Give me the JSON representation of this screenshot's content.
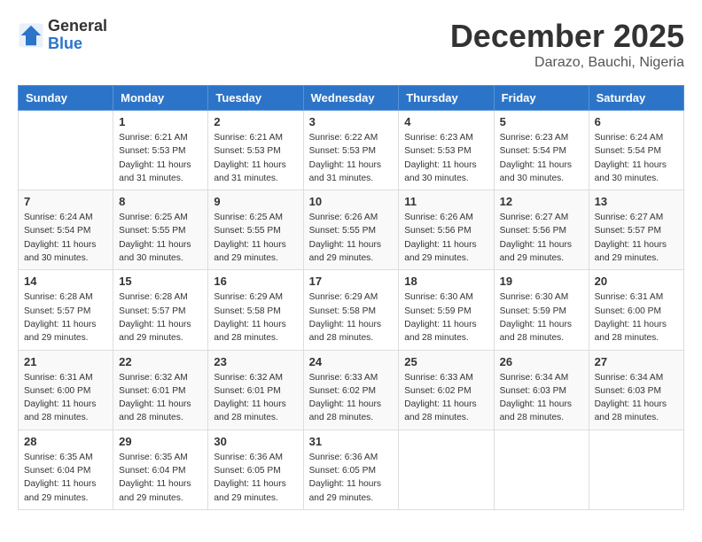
{
  "header": {
    "logo_line1": "General",
    "logo_line2": "Blue",
    "title": "December 2025",
    "subtitle": "Darazo, Bauchi, Nigeria"
  },
  "calendar": {
    "days_of_week": [
      "Sunday",
      "Monday",
      "Tuesday",
      "Wednesday",
      "Thursday",
      "Friday",
      "Saturday"
    ],
    "weeks": [
      [
        {
          "day": "",
          "sunrise": "",
          "sunset": "",
          "daylight": ""
        },
        {
          "day": "1",
          "sunrise": "Sunrise: 6:21 AM",
          "sunset": "Sunset: 5:53 PM",
          "daylight": "Daylight: 11 hours and 31 minutes."
        },
        {
          "day": "2",
          "sunrise": "Sunrise: 6:21 AM",
          "sunset": "Sunset: 5:53 PM",
          "daylight": "Daylight: 11 hours and 31 minutes."
        },
        {
          "day": "3",
          "sunrise": "Sunrise: 6:22 AM",
          "sunset": "Sunset: 5:53 PM",
          "daylight": "Daylight: 11 hours and 31 minutes."
        },
        {
          "day": "4",
          "sunrise": "Sunrise: 6:23 AM",
          "sunset": "Sunset: 5:53 PM",
          "daylight": "Daylight: 11 hours and 30 minutes."
        },
        {
          "day": "5",
          "sunrise": "Sunrise: 6:23 AM",
          "sunset": "Sunset: 5:54 PM",
          "daylight": "Daylight: 11 hours and 30 minutes."
        },
        {
          "day": "6",
          "sunrise": "Sunrise: 6:24 AM",
          "sunset": "Sunset: 5:54 PM",
          "daylight": "Daylight: 11 hours and 30 minutes."
        }
      ],
      [
        {
          "day": "7",
          "sunrise": "Sunrise: 6:24 AM",
          "sunset": "Sunset: 5:54 PM",
          "daylight": "Daylight: 11 hours and 30 minutes."
        },
        {
          "day": "8",
          "sunrise": "Sunrise: 6:25 AM",
          "sunset": "Sunset: 5:55 PM",
          "daylight": "Daylight: 11 hours and 30 minutes."
        },
        {
          "day": "9",
          "sunrise": "Sunrise: 6:25 AM",
          "sunset": "Sunset: 5:55 PM",
          "daylight": "Daylight: 11 hours and 29 minutes."
        },
        {
          "day": "10",
          "sunrise": "Sunrise: 6:26 AM",
          "sunset": "Sunset: 5:55 PM",
          "daylight": "Daylight: 11 hours and 29 minutes."
        },
        {
          "day": "11",
          "sunrise": "Sunrise: 6:26 AM",
          "sunset": "Sunset: 5:56 PM",
          "daylight": "Daylight: 11 hours and 29 minutes."
        },
        {
          "day": "12",
          "sunrise": "Sunrise: 6:27 AM",
          "sunset": "Sunset: 5:56 PM",
          "daylight": "Daylight: 11 hours and 29 minutes."
        },
        {
          "day": "13",
          "sunrise": "Sunrise: 6:27 AM",
          "sunset": "Sunset: 5:57 PM",
          "daylight": "Daylight: 11 hours and 29 minutes."
        }
      ],
      [
        {
          "day": "14",
          "sunrise": "Sunrise: 6:28 AM",
          "sunset": "Sunset: 5:57 PM",
          "daylight": "Daylight: 11 hours and 29 minutes."
        },
        {
          "day": "15",
          "sunrise": "Sunrise: 6:28 AM",
          "sunset": "Sunset: 5:57 PM",
          "daylight": "Daylight: 11 hours and 29 minutes."
        },
        {
          "day": "16",
          "sunrise": "Sunrise: 6:29 AM",
          "sunset": "Sunset: 5:58 PM",
          "daylight": "Daylight: 11 hours and 28 minutes."
        },
        {
          "day": "17",
          "sunrise": "Sunrise: 6:29 AM",
          "sunset": "Sunset: 5:58 PM",
          "daylight": "Daylight: 11 hours and 28 minutes."
        },
        {
          "day": "18",
          "sunrise": "Sunrise: 6:30 AM",
          "sunset": "Sunset: 5:59 PM",
          "daylight": "Daylight: 11 hours and 28 minutes."
        },
        {
          "day": "19",
          "sunrise": "Sunrise: 6:30 AM",
          "sunset": "Sunset: 5:59 PM",
          "daylight": "Daylight: 11 hours and 28 minutes."
        },
        {
          "day": "20",
          "sunrise": "Sunrise: 6:31 AM",
          "sunset": "Sunset: 6:00 PM",
          "daylight": "Daylight: 11 hours and 28 minutes."
        }
      ],
      [
        {
          "day": "21",
          "sunrise": "Sunrise: 6:31 AM",
          "sunset": "Sunset: 6:00 PM",
          "daylight": "Daylight: 11 hours and 28 minutes."
        },
        {
          "day": "22",
          "sunrise": "Sunrise: 6:32 AM",
          "sunset": "Sunset: 6:01 PM",
          "daylight": "Daylight: 11 hours and 28 minutes."
        },
        {
          "day": "23",
          "sunrise": "Sunrise: 6:32 AM",
          "sunset": "Sunset: 6:01 PM",
          "daylight": "Daylight: 11 hours and 28 minutes."
        },
        {
          "day": "24",
          "sunrise": "Sunrise: 6:33 AM",
          "sunset": "Sunset: 6:02 PM",
          "daylight": "Daylight: 11 hours and 28 minutes."
        },
        {
          "day": "25",
          "sunrise": "Sunrise: 6:33 AM",
          "sunset": "Sunset: 6:02 PM",
          "daylight": "Daylight: 11 hours and 28 minutes."
        },
        {
          "day": "26",
          "sunrise": "Sunrise: 6:34 AM",
          "sunset": "Sunset: 6:03 PM",
          "daylight": "Daylight: 11 hours and 28 minutes."
        },
        {
          "day": "27",
          "sunrise": "Sunrise: 6:34 AM",
          "sunset": "Sunset: 6:03 PM",
          "daylight": "Daylight: 11 hours and 28 minutes."
        }
      ],
      [
        {
          "day": "28",
          "sunrise": "Sunrise: 6:35 AM",
          "sunset": "Sunset: 6:04 PM",
          "daylight": "Daylight: 11 hours and 29 minutes."
        },
        {
          "day": "29",
          "sunrise": "Sunrise: 6:35 AM",
          "sunset": "Sunset: 6:04 PM",
          "daylight": "Daylight: 11 hours and 29 minutes."
        },
        {
          "day": "30",
          "sunrise": "Sunrise: 6:36 AM",
          "sunset": "Sunset: 6:05 PM",
          "daylight": "Daylight: 11 hours and 29 minutes."
        },
        {
          "day": "31",
          "sunrise": "Sunrise: 6:36 AM",
          "sunset": "Sunset: 6:05 PM",
          "daylight": "Daylight: 11 hours and 29 minutes."
        },
        {
          "day": "",
          "sunrise": "",
          "sunset": "",
          "daylight": ""
        },
        {
          "day": "",
          "sunrise": "",
          "sunset": "",
          "daylight": ""
        },
        {
          "day": "",
          "sunrise": "",
          "sunset": "",
          "daylight": ""
        }
      ]
    ]
  }
}
